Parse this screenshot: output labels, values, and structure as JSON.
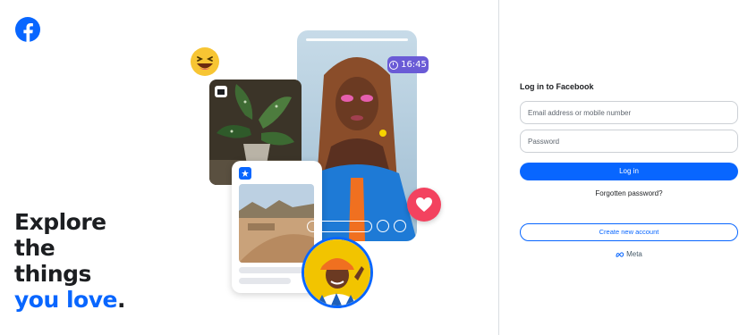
{
  "brand": {
    "logo_icon": "facebook-logo-icon",
    "color": "#0866ff"
  },
  "hero": {
    "line1": "Explore",
    "line2": "the",
    "line3": "things",
    "line4_accent": "you love",
    "line4_end": "."
  },
  "collage": {
    "time_label": "16:45",
    "icons": [
      "laughing-emoji-icon",
      "heart-icon",
      "clock-icon",
      "shop-icon",
      "star-badge-icon"
    ]
  },
  "login": {
    "title": "Log in to Facebook",
    "email_placeholder": "Email address or mobile number",
    "password_placeholder": "Password",
    "login_label": "Log in",
    "forgot_label": "Forgotten password?",
    "create_label": "Create new account",
    "meta_label": "Meta"
  }
}
